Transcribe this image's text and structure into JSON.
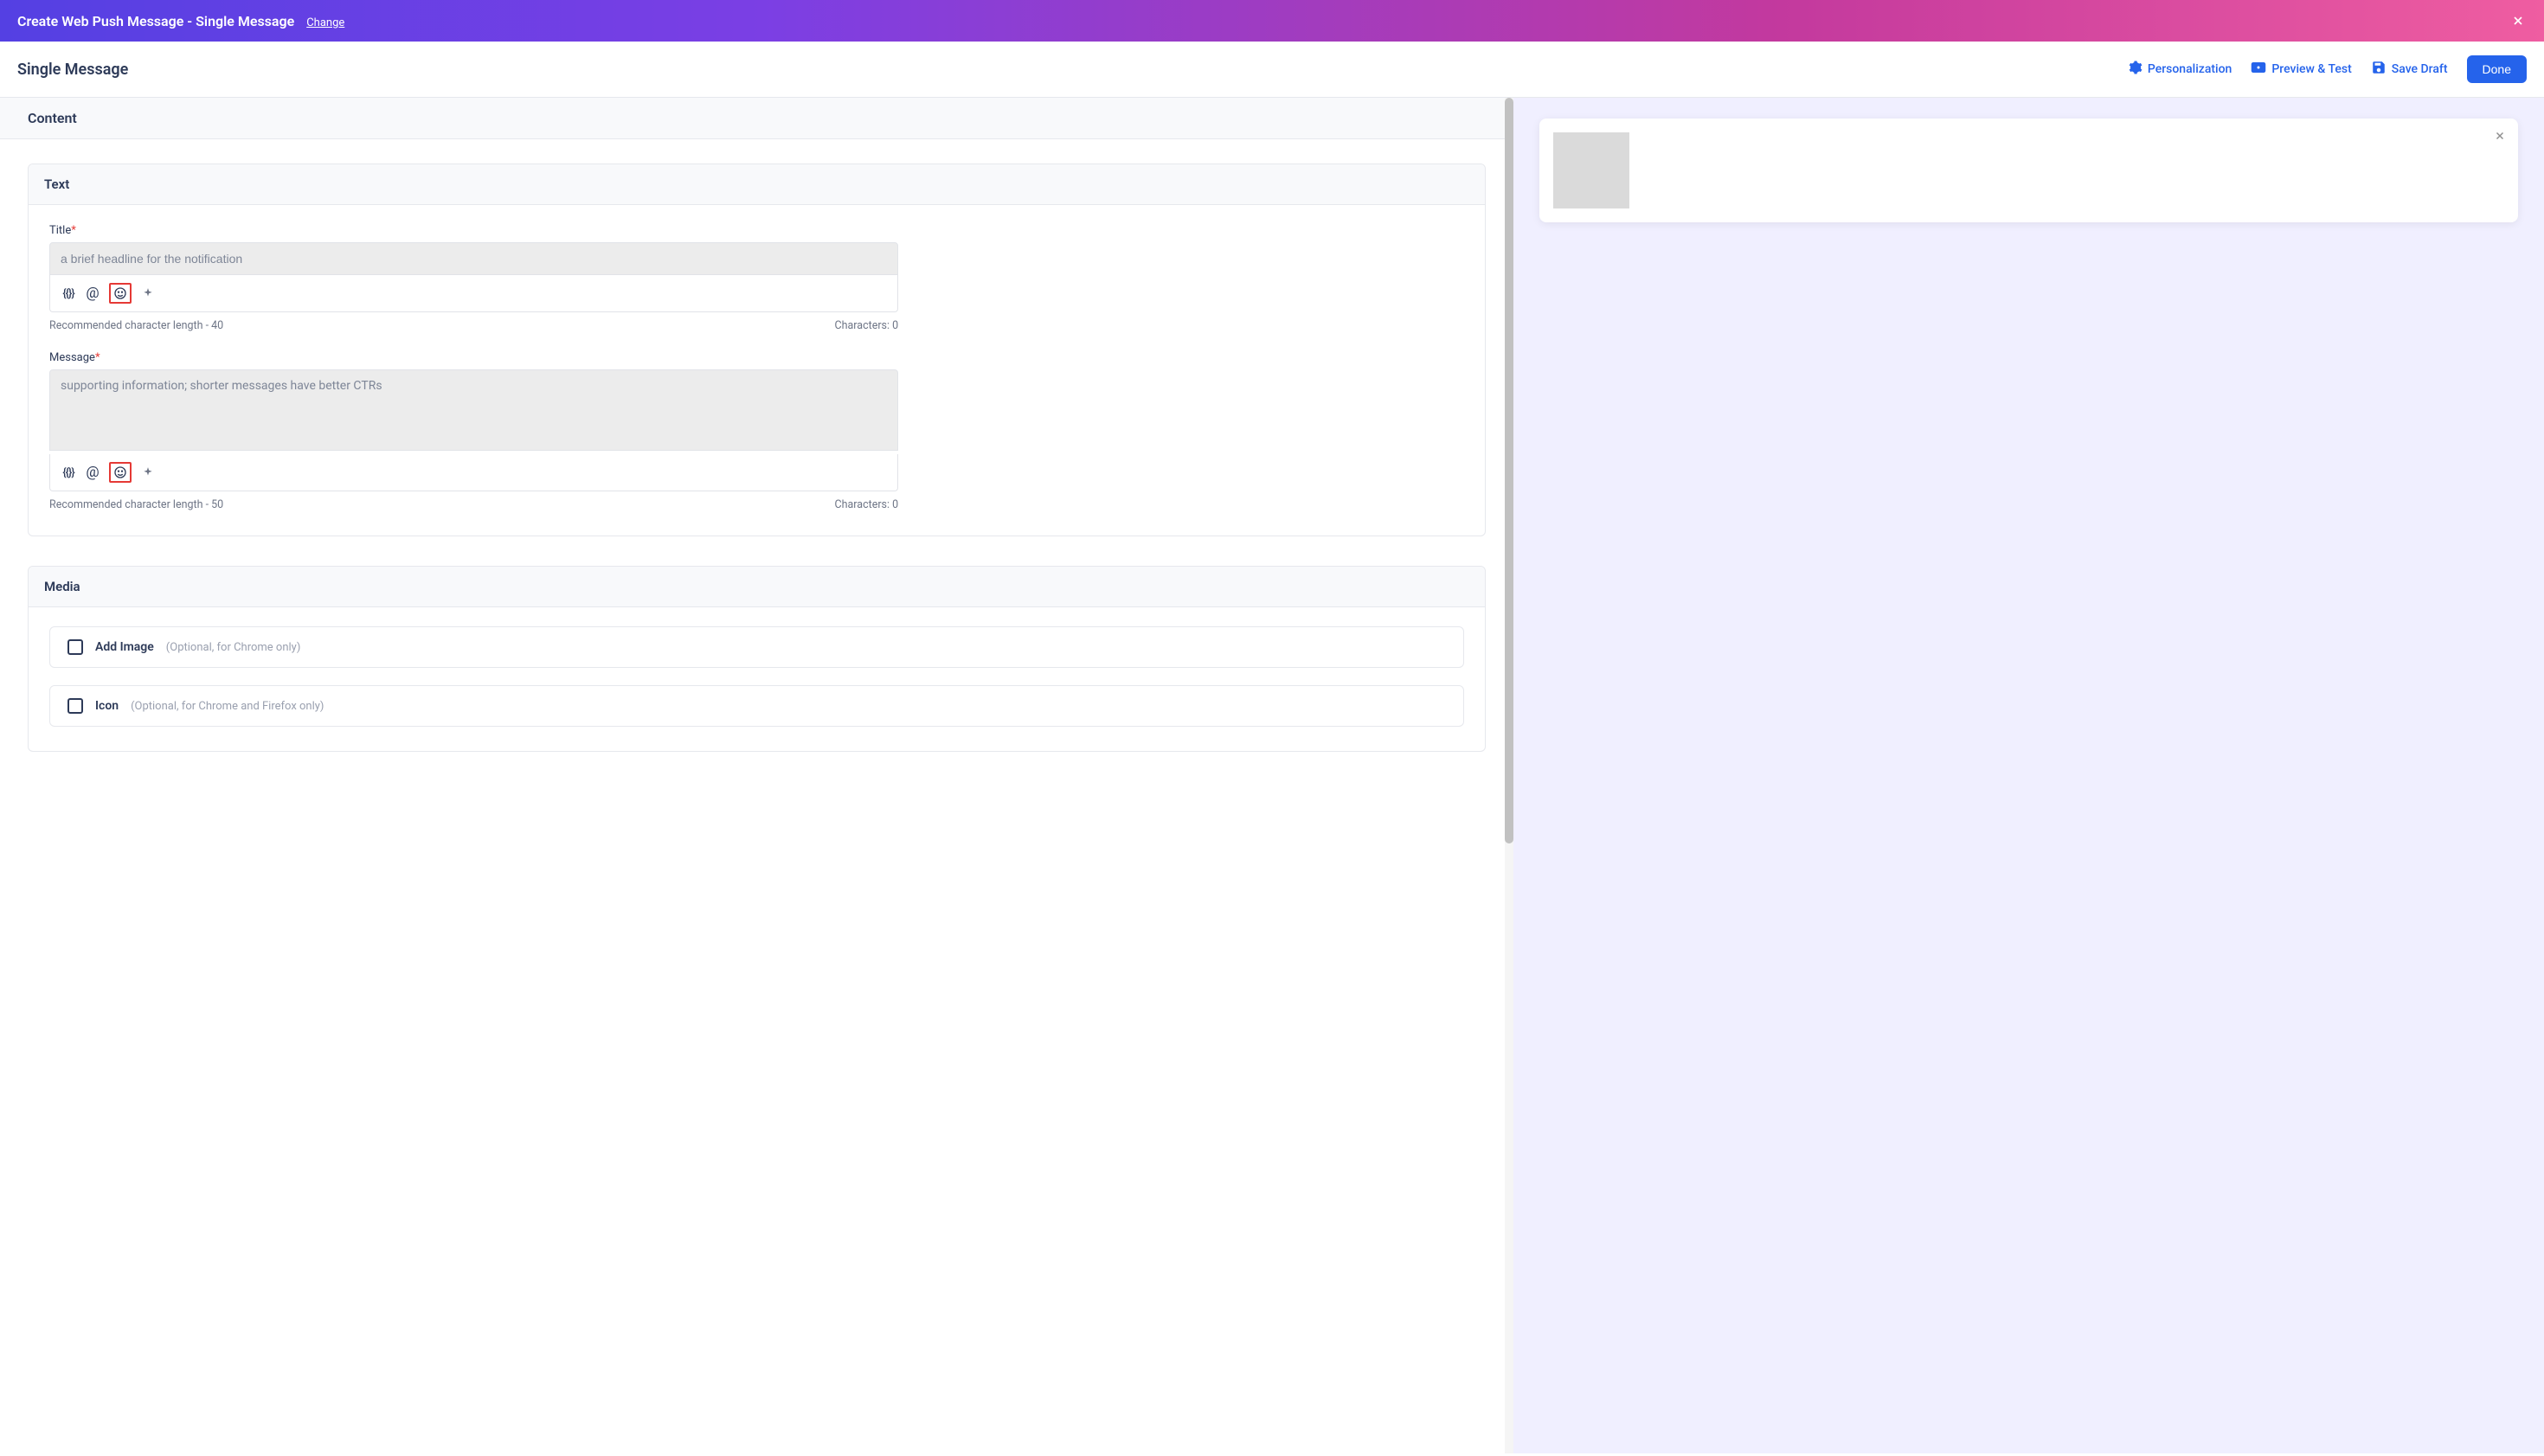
{
  "top_bar": {
    "title": "Create Web Push Message - Single Message",
    "change_label": "Change"
  },
  "sub_header": {
    "title": "Single Message",
    "actions": {
      "personalization": "Personalization",
      "preview_test": "Preview & Test",
      "save_draft": "Save Draft",
      "done": "Done"
    }
  },
  "content": {
    "section_title": "Content",
    "text_card": {
      "title": "Text",
      "title_field": {
        "label": "Title",
        "placeholder": "a brief headline for the notification",
        "rec_length": "Recommended character length - 40",
        "char_count": "Characters: 0"
      },
      "message_field": {
        "label": "Message",
        "placeholder": "supporting information; shorter messages have better CTRs",
        "rec_length": "Recommended character length - 50",
        "char_count": "Characters: 0"
      }
    },
    "media_card": {
      "title": "Media",
      "add_image": {
        "label": "Add Image",
        "hint": "(Optional, for Chrome only)"
      },
      "icon": {
        "label": "Icon",
        "hint": "(Optional, for Chrome and Firefox only)"
      }
    }
  }
}
